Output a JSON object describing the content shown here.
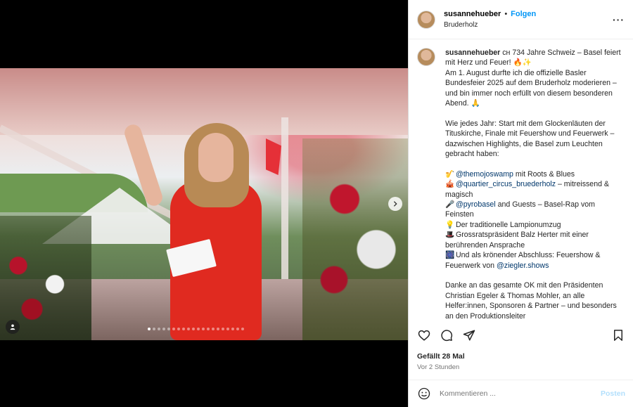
{
  "colors": {
    "follow_blue": "#0095f6",
    "mention_blue": "#00376b",
    "post_disabled": "#b2dffc"
  },
  "media": {
    "next_icon": "chevron-right-icon",
    "user_tag_icon": "person-icon",
    "carousel_total": 20,
    "carousel_active_index": 0
  },
  "header": {
    "username": "susannehueber",
    "separator": "•",
    "follow_label": "Folgen",
    "location": "Bruderholz",
    "more_icon": "more-horizontal-icon",
    "more_label": "···"
  },
  "caption": {
    "username": "susannehueber",
    "line1_rest": " ᴄʜ 734 Jahre Schweiz – Basel feiert mit Herz und Feuer! 🔥✨",
    "line2": "Am 1. August durfte ich die offizielle Basler Bundesfeier 2025 auf dem Bruderholz moderieren – und bin immer noch erfüllt von diesem besonderen Abend. 🙏",
    "line3": "Wie jedes Jahr: Start mit dem Glockenläuten der Tituskirche, Finale mit Feuershow und Feuerwerk – dazwischen Highlights, die Basel zum Leuchten gebracht haben:",
    "item1_emoji": "🎷",
    "item1_mention": "@themojoswamp",
    "item1_text": " mit Roots & Blues",
    "item2_emoji": "🎪",
    "item2_mention": "@quartier_circus_bruederholz",
    "item2_text": " – mitreissend & magisch",
    "item3_emoji": "🎤",
    "item3_mention": "@pyrobasel",
    "item3_text": " and Guests – Basel-Rap vom Feinsten",
    "item4_emoji": "💡",
    "item4_text": "Der traditionelle Lampionumzug",
    "item5_emoji": "🎩",
    "item5_text": "Grossratspräsident Balz Herter mit einer berührenden Ansprache",
    "item6_emoji": "🎆",
    "item6_text": "Und als krönender Abschluss: Feuershow & Feuerwerk von ",
    "item6_mention": "@ziegler.shows",
    "line4": "Danke an das gesamte OK mit den Präsidenten Christian Egeler & Thomas Mohler, an alle Helfer:innen, Sponsoren & Partner – und besonders an den Produktionsleiter"
  },
  "actions": {
    "like_icon": "heart-icon",
    "comment_icon": "comment-icon",
    "share_icon": "send-icon",
    "save_icon": "bookmark-icon"
  },
  "stats": {
    "likes": "Gefällt 28 Mal",
    "time": "Vor 2 Stunden"
  },
  "comment": {
    "emoji_icon": "smiley-icon",
    "placeholder": "Kommentieren ...",
    "post_label": "Posten"
  }
}
